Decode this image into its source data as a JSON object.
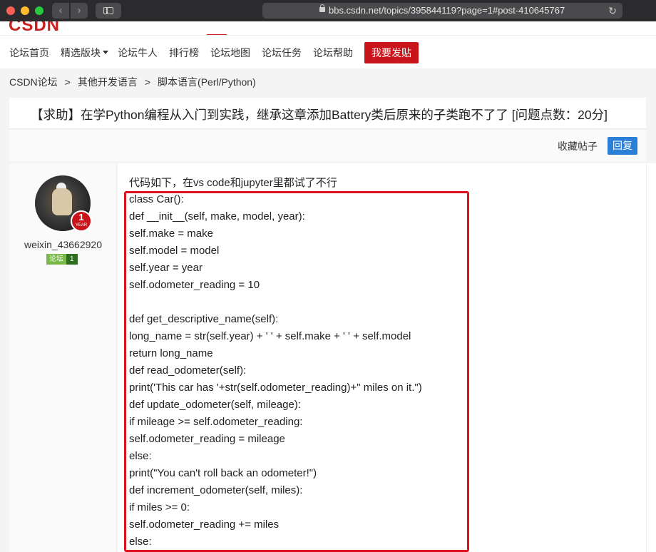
{
  "browser": {
    "url": "bbs.csdn.net/topics/395844119?page=1#post-410645767",
    "back_glyph": "‹",
    "forward_glyph": "›",
    "reload_glyph": "↻"
  },
  "site": {
    "logo": "CSDN",
    "brand_color": "#c9141b"
  },
  "nav": {
    "items": [
      {
        "label": "论坛首页"
      },
      {
        "label": "精选版块"
      },
      {
        "label": "论坛牛人"
      },
      {
        "label": "排行榜"
      },
      {
        "label": "论坛地图"
      },
      {
        "label": "论坛任务"
      },
      {
        "label": "论坛帮助"
      }
    ],
    "post_button": "我要发贴"
  },
  "breadcrumb": {
    "items": [
      "CSDN论坛",
      "其他开发语言",
      "脚本语言(Perl/Python)"
    ],
    "separator": ">"
  },
  "topic": {
    "title": "【求助】在学Python编程从入门到实践，继承这章添加Battery类后原来的子类跑不了了 [问题点数：20分]",
    "favorite_label": "收藏帖子",
    "reply_label": "回复"
  },
  "author": {
    "username": "weixin_43662920",
    "year_badge_num": "1",
    "year_badge_label": "YEAR",
    "level_name": "论坛",
    "level_num": "1"
  },
  "post": {
    "intro": "代码如下，在vs code和jupyter里都试了不行",
    "code_lines": [
      "class Car():",
      "def __init__(self, make, model, year):",
      "self.make = make",
      "self.model = model",
      "self.year = year",
      "self.odometer_reading = 10",
      "",
      "def get_descriptive_name(self):",
      "long_name = str(self.year) + ' ' + self.make + ' ' + self.model",
      "return long_name",
      "def read_odometer(self):",
      "print('This car has '+str(self.odometer_reading)+\" miles on it.\")",
      "def update_odometer(self, mileage):",
      "if mileage >= self.odometer_reading:",
      "self.odometer_reading = mileage",
      "else:",
      "print(\"You can't roll back an odometer!\")",
      "def increment_odometer(self, miles):",
      "if miles >= 0:",
      "self.odometer_reading += miles",
      "else:"
    ],
    "highlight_color": "#e0111f"
  }
}
